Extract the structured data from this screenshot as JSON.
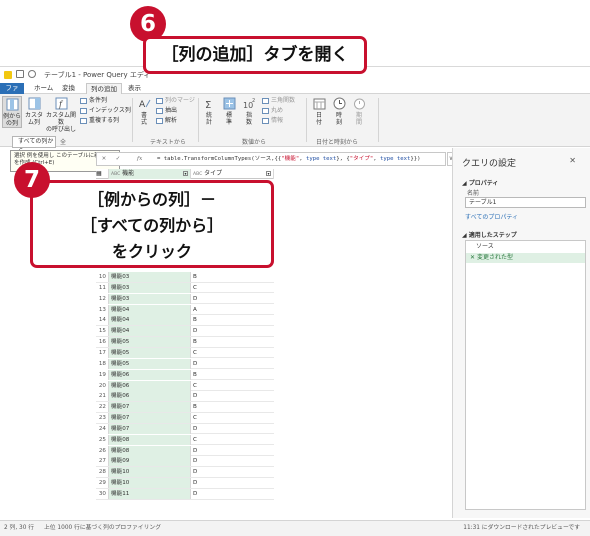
{
  "window": {
    "title": "テーブル1 - Power Query エディ"
  },
  "menu_tabs": [
    {
      "label": "ファイル"
    },
    {
      "label": "ホーム"
    },
    {
      "label": "変換"
    },
    {
      "label": "列の追加"
    },
    {
      "label": "表示"
    }
  ],
  "ribbon": {
    "example_column": "例から\nの列",
    "custom_column": "カスタ\nム列",
    "custom_function": "カスタム関数\nの呼び出し",
    "conditional_column": "条件列",
    "index_column": "インデックス列",
    "duplicate_column": "重複する列",
    "format": "書\n式",
    "merge_columns": "列のマージ",
    "extract": "抽出",
    "parse": "解析",
    "text_group": "テキストから",
    "statistics": "統\n計",
    "standard": "標\n準",
    "scientific": "指\n数",
    "trigonometry": "三角関数",
    "rounding": "丸め",
    "information": "情報",
    "number_group": "数値から",
    "date": "日\n付",
    "time": "時\n刻",
    "duration": "期\n間",
    "datetime_group": "日付と時刻から",
    "general_group": "全"
  },
  "dropdown": {
    "label": "すべての列から",
    "item_prefix": "選択"
  },
  "tooltip": {
    "text": "例を使用し  このテーブルに新し\nを作成  (Ctrl+E)"
  },
  "formula": {
    "prefix": "= table.TransformColumnTypes(ソース,{{",
    "s1": "\"機能\"",
    "mid1": ", ",
    "t1": "type text",
    "mid2": "}, {",
    "s2": "\"タイプ\"",
    "mid3": ", ",
    "t2": "type text",
    "suffix": "}})",
    "fx": "fx"
  },
  "table": {
    "columns": [
      "機能",
      "タイプ"
    ],
    "col_type_icon": "ABC",
    "rows": [
      {
        "n": "10",
        "a": "機能03",
        "b": "B"
      },
      {
        "n": "11",
        "a": "機能03",
        "b": "C"
      },
      {
        "n": "12",
        "a": "機能03",
        "b": "D"
      },
      {
        "n": "13",
        "a": "機能04",
        "b": "A"
      },
      {
        "n": "14",
        "a": "機能04",
        "b": "B"
      },
      {
        "n": "15",
        "a": "機能04",
        "b": "D"
      },
      {
        "n": "16",
        "a": "機能05",
        "b": "B"
      },
      {
        "n": "17",
        "a": "機能05",
        "b": "C"
      },
      {
        "n": "18",
        "a": "機能05",
        "b": "D"
      },
      {
        "n": "19",
        "a": "機能06",
        "b": "B"
      },
      {
        "n": "20",
        "a": "機能06",
        "b": "C"
      },
      {
        "n": "21",
        "a": "機能06",
        "b": "D"
      },
      {
        "n": "22",
        "a": "機能07",
        "b": "B"
      },
      {
        "n": "23",
        "a": "機能07",
        "b": "C"
      },
      {
        "n": "24",
        "a": "機能07",
        "b": "D"
      },
      {
        "n": "25",
        "a": "機能08",
        "b": "C"
      },
      {
        "n": "26",
        "a": "機能08",
        "b": "D"
      },
      {
        "n": "27",
        "a": "機能09",
        "b": "D"
      },
      {
        "n": "28",
        "a": "機能10",
        "b": "D"
      },
      {
        "n": "29",
        "a": "機能10",
        "b": "D"
      },
      {
        "n": "30",
        "a": "機能11",
        "b": "D"
      }
    ]
  },
  "query_settings": {
    "title": "クエリの設定",
    "properties_label": "プロパティ",
    "name_label": "名前",
    "name_value": "テーブル1",
    "all_properties": "すべてのプロパティ",
    "applied_steps_label": "適用したステップ",
    "steps": [
      "ソース",
      "変更された型"
    ]
  },
  "statusbar": {
    "left": "2 列, 30 行",
    "profiling": "上位 1000 行に基づく列のプロファイリング",
    "right": "11:31 にダウンロードされたプレビューです"
  },
  "annotations": {
    "badge6": "6",
    "callout6": "［列の追加］タブを開く",
    "badge7": "7",
    "callout7": "［例からの列］－\n［すべての列から］\nをクリック"
  },
  "colors": {
    "accent_red": "#c8102e",
    "file_tab_blue": "#2b6fb6",
    "selected_column_green": "#dff0e4"
  }
}
